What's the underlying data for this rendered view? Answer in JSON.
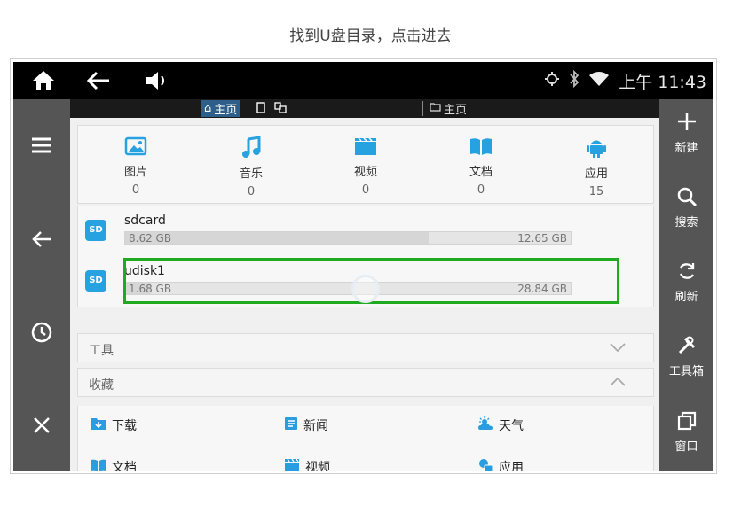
{
  "caption": "找到U盘目录，点击进去",
  "status_bar": {
    "time": "上午 11:43",
    "icons": [
      "home-icon",
      "back-arrow-icon",
      "volume-icon",
      "location-icon",
      "bluetooth-icon",
      "wifi-icon"
    ]
  },
  "tabs": {
    "left_label": "主页",
    "right_label": "主页"
  },
  "categories": [
    {
      "label": "图片",
      "count": "0",
      "icon": "picture-icon"
    },
    {
      "label": "音乐",
      "count": "0",
      "icon": "music-icon"
    },
    {
      "label": "视频",
      "count": "0",
      "icon": "video-icon"
    },
    {
      "label": "文档",
      "count": "0",
      "icon": "document-icon"
    },
    {
      "label": "应用",
      "count": "15",
      "icon": "android-icon"
    }
  ],
  "storage": [
    {
      "name": "sdcard",
      "used": "8.62 GB",
      "total": "12.65 GB",
      "fill_fraction": 0.681,
      "icon_label": "SD"
    },
    {
      "name": "udisk1",
      "used": "1.68 GB",
      "total": "28.84 GB",
      "fill_fraction": 0.058,
      "icon_label": "SD"
    }
  ],
  "sections": {
    "tools": "工具",
    "favorites": "收藏"
  },
  "favorites": [
    {
      "label": "下载",
      "icon": "download-folder-icon",
      "color": "#2a9de0"
    },
    {
      "label": "新闻",
      "icon": "news-icon",
      "color": "#2a9de0"
    },
    {
      "label": "天气",
      "icon": "weather-icon",
      "color": "#2a9de0"
    },
    {
      "label": "文档",
      "icon": "book-icon",
      "color": "#2a9de0"
    },
    {
      "label": "视频",
      "icon": "video-icon",
      "color": "#2a9de0"
    },
    {
      "label": "应用",
      "icon": "apps-icon",
      "color": "#2a9de0"
    }
  ],
  "right_rail": [
    {
      "label": "新建",
      "icon": "plus-icon"
    },
    {
      "label": "搜索",
      "icon": "search-icon"
    },
    {
      "label": "刷新",
      "icon": "refresh-icon"
    },
    {
      "label": "工具箱",
      "icon": "toolbox-icon"
    },
    {
      "label": "窗口",
      "icon": "window-icon"
    }
  ],
  "colors": {
    "accent": "#27a2e0",
    "highlight": "#1faa1f",
    "rail": "#555555"
  }
}
